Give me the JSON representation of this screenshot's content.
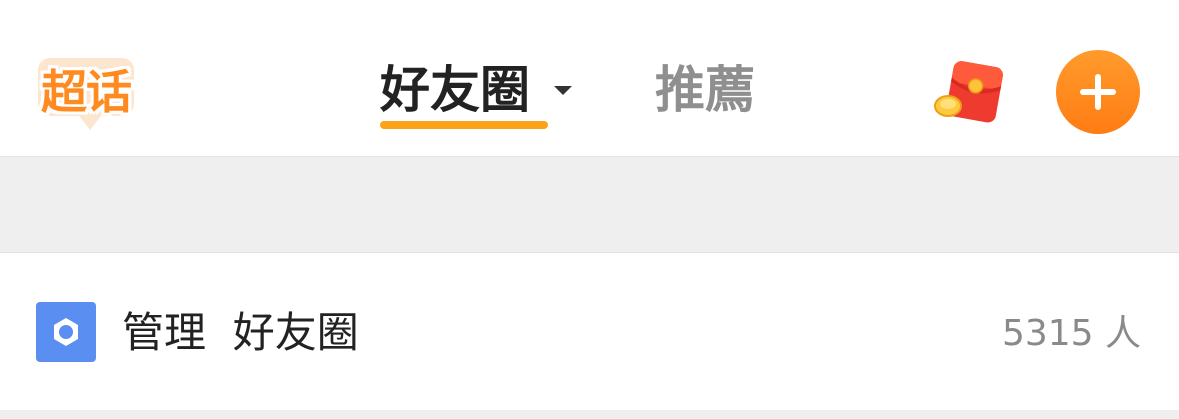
{
  "header": {
    "logo_text": "超话",
    "tabs": [
      {
        "label": "好友圈",
        "active": true
      },
      {
        "label": "推薦",
        "active": false
      }
    ],
    "icons": {
      "dropdown": "chevron-down-icon",
      "red_packet": "red-packet-icon",
      "add": "plus-icon"
    },
    "accent_color": "#ff8a1f"
  },
  "row": {
    "icon": "gear-icon",
    "title": "管理  好友圈",
    "count": "5315 人"
  }
}
